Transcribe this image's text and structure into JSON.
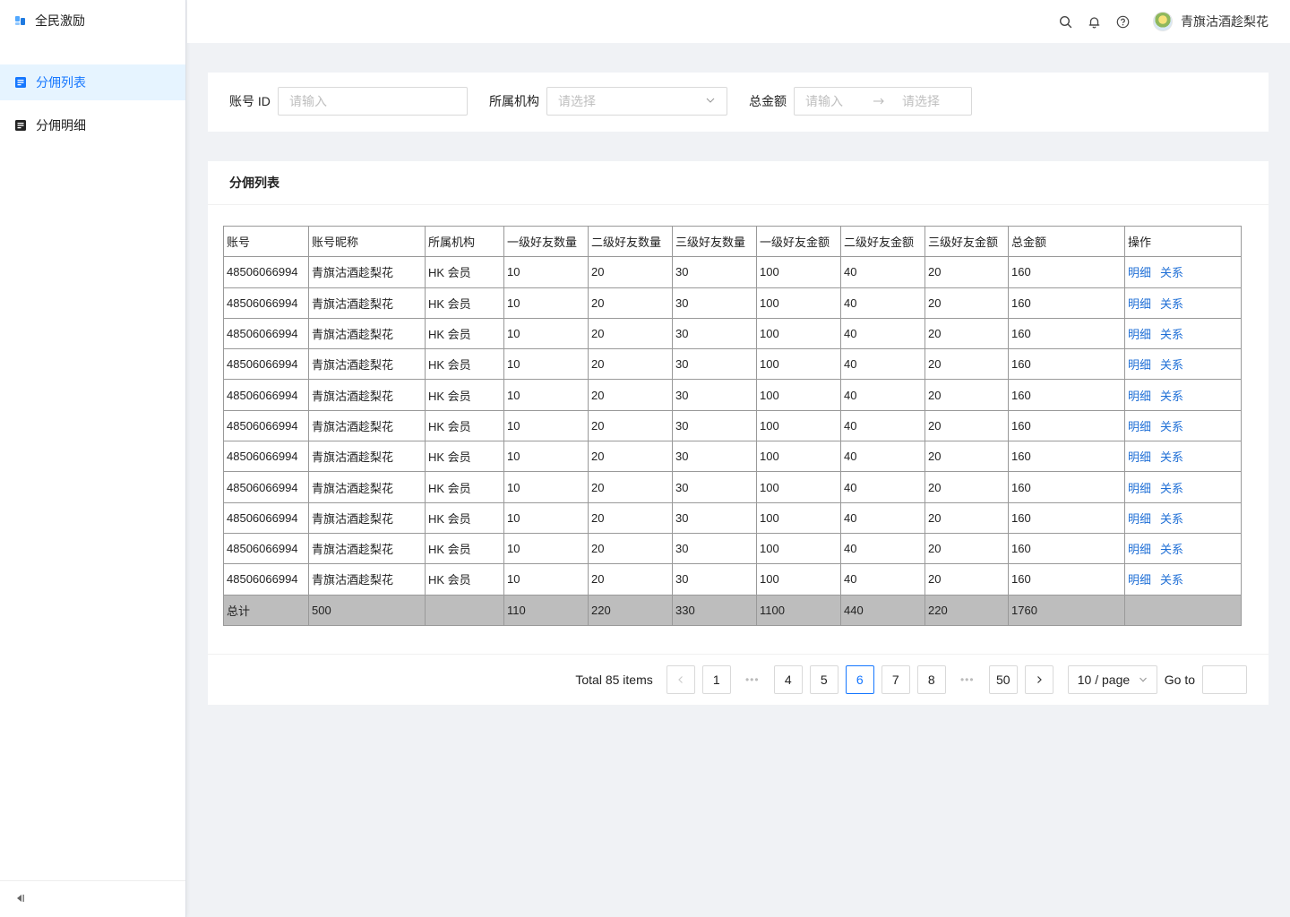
{
  "app": {
    "name": "全民激励"
  },
  "sidebar": {
    "items": [
      {
        "label": "分佣列表",
        "active": true
      },
      {
        "label": "分佣明细",
        "active": false
      }
    ]
  },
  "header": {
    "username": "青旗沽酒趁梨花"
  },
  "filters": {
    "account_label": "账号 ID",
    "account_placeholder": "请输入",
    "org_label": "所属机构",
    "org_placeholder": "请选择",
    "amount_label": "总金额",
    "amount_from_placeholder": "请输入",
    "amount_to_placeholder": "请选择"
  },
  "table": {
    "title": "分佣列表",
    "columns": [
      "账号",
      "账号昵称",
      "所属机构",
      "一级好友数量",
      "二级好友数量",
      "三级好友数量",
      "一级好友金额",
      "二级好友金额",
      "三级好友金额",
      "总金额",
      "操作"
    ],
    "rows": [
      [
        "48506066994",
        "青旗沽酒趁梨花",
        "HK 会员",
        "10",
        "20",
        "30",
        "100",
        "40",
        "20",
        "160"
      ],
      [
        "48506066994",
        "青旗沽酒趁梨花",
        "HK 会员",
        "10",
        "20",
        "30",
        "100",
        "40",
        "20",
        "160"
      ],
      [
        "48506066994",
        "青旗沽酒趁梨花",
        "HK 会员",
        "10",
        "20",
        "30",
        "100",
        "40",
        "20",
        "160"
      ],
      [
        "48506066994",
        "青旗沽酒趁梨花",
        "HK 会员",
        "10",
        "20",
        "30",
        "100",
        "40",
        "20",
        "160"
      ],
      [
        "48506066994",
        "青旗沽酒趁梨花",
        "HK 会员",
        "10",
        "20",
        "30",
        "100",
        "40",
        "20",
        "160"
      ],
      [
        "48506066994",
        "青旗沽酒趁梨花",
        "HK 会员",
        "10",
        "20",
        "30",
        "100",
        "40",
        "20",
        "160"
      ],
      [
        "48506066994",
        "青旗沽酒趁梨花",
        "HK 会员",
        "10",
        "20",
        "30",
        "100",
        "40",
        "20",
        "160"
      ],
      [
        "48506066994",
        "青旗沽酒趁梨花",
        "HK 会员",
        "10",
        "20",
        "30",
        "100",
        "40",
        "20",
        "160"
      ],
      [
        "48506066994",
        "青旗沽酒趁梨花",
        "HK 会员",
        "10",
        "20",
        "30",
        "100",
        "40",
        "20",
        "160"
      ],
      [
        "48506066994",
        "青旗沽酒趁梨花",
        "HK 会员",
        "10",
        "20",
        "30",
        "100",
        "40",
        "20",
        "160"
      ],
      [
        "48506066994",
        "青旗沽酒趁梨花",
        "HK 会员",
        "10",
        "20",
        "30",
        "100",
        "40",
        "20",
        "160"
      ]
    ],
    "actions": [
      "明细",
      "关系"
    ],
    "total_row": [
      "总计",
      "500",
      "",
      "110",
      "220",
      "330",
      "1100",
      "440",
      "220",
      "1760",
      ""
    ]
  },
  "pagination": {
    "total_text": "Total 85 items",
    "pages": [
      "1",
      "•••",
      "4",
      "5",
      "6",
      "7",
      "8",
      "•••",
      "50"
    ],
    "current": "6",
    "page_size": "10 / page",
    "goto_label": "Go to",
    "goto_value": ""
  },
  "colors": {
    "primary": "#1677ff",
    "link": "#1f6fd6",
    "total_row_bg": "#bdbdbd"
  },
  "icons": {
    "logo": "app-logo-icon",
    "menu_list": "list-doc-icon",
    "menu_detail": "detail-doc-icon",
    "search": "search-icon",
    "bell": "bell-icon",
    "help": "help-icon",
    "collapse": "collapse-sidebar-icon"
  }
}
